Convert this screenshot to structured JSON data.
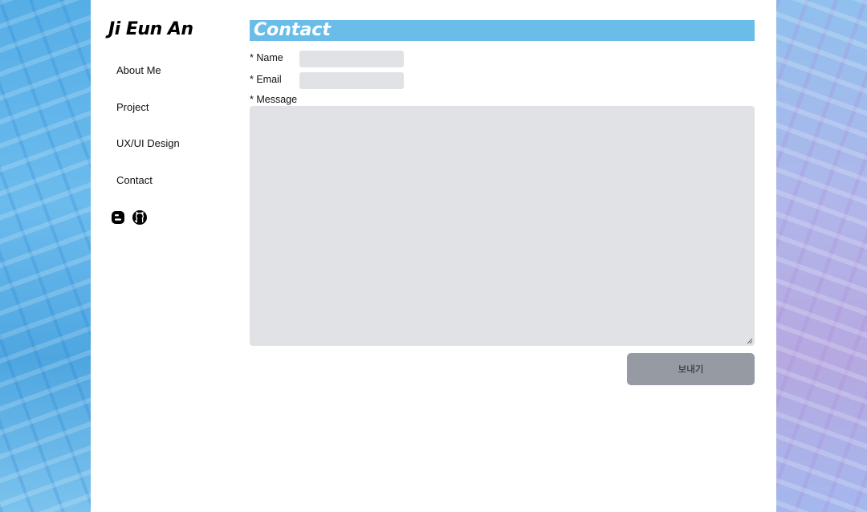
{
  "site": {
    "logo": "Ji Eun An"
  },
  "nav": {
    "items": [
      {
        "label": "About Me"
      },
      {
        "label": "Project"
      },
      {
        "label": "UX/UI Design"
      },
      {
        "label": "Contact"
      }
    ]
  },
  "socials": {
    "icons": [
      "blogger-icon",
      "github-icon"
    ]
  },
  "contact": {
    "heading": "Contact",
    "name_label": "* Name",
    "email_label": "* Email",
    "message_label": "* Message",
    "name_value": "",
    "email_value": "",
    "message_value": "",
    "submit_label": "보내기"
  },
  "colors": {
    "heading_bg": "#6abde8",
    "field_bg": "#e1e2e6",
    "button_bg": "#959aa3"
  }
}
